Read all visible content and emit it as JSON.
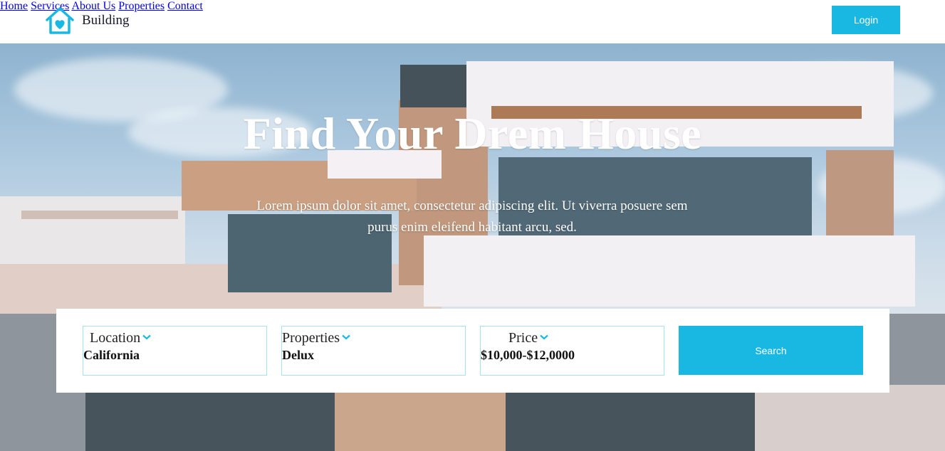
{
  "brand": {
    "name": "Building",
    "icon": "house-heart-icon",
    "accent": "#19b8e3"
  },
  "nav": {
    "items": [
      "Home",
      "Services",
      "About Us",
      "Properties",
      "Contact"
    ]
  },
  "login_label": "Login",
  "hero": {
    "title": "Find Your Drem House",
    "subtitle": "Lorem ipsum dolor sit amet, consectetur adipiscing elit. Ut viverra posuere sem purus enim eleifend habitant arcu, sed."
  },
  "search": {
    "fields": [
      {
        "label": "Location",
        "value": "California"
      },
      {
        "label": "Properties",
        "value": "Delux"
      },
      {
        "label": "Price",
        "value": "$10,000-$12,0000"
      }
    ],
    "button_label": "Search"
  },
  "colors": {
    "accent": "#19b8e3",
    "field_border": "#a9e2ef"
  }
}
